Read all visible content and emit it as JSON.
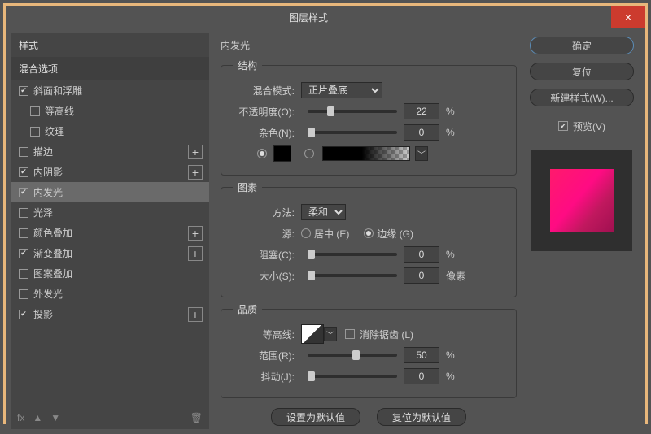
{
  "window": {
    "title": "图层样式",
    "close": "×"
  },
  "sidebar": {
    "styles_label": "样式",
    "blend_label": "混合选项",
    "items": [
      {
        "label": "斜面和浮雕",
        "checked": true,
        "plus": false,
        "indent": 0
      },
      {
        "label": "等高线",
        "checked": false,
        "plus": false,
        "indent": 1
      },
      {
        "label": "纹理",
        "checked": false,
        "plus": false,
        "indent": 1
      },
      {
        "label": "描边",
        "checked": false,
        "plus": true,
        "indent": 0
      },
      {
        "label": "内阴影",
        "checked": true,
        "plus": true,
        "indent": 0
      },
      {
        "label": "内发光",
        "checked": true,
        "plus": false,
        "indent": 0,
        "selected": true
      },
      {
        "label": "光泽",
        "checked": false,
        "plus": false,
        "indent": 0
      },
      {
        "label": "颜色叠加",
        "checked": false,
        "plus": true,
        "indent": 0
      },
      {
        "label": "渐变叠加",
        "checked": true,
        "plus": true,
        "indent": 0
      },
      {
        "label": "图案叠加",
        "checked": false,
        "plus": false,
        "indent": 0
      },
      {
        "label": "外发光",
        "checked": false,
        "plus": false,
        "indent": 0
      },
      {
        "label": "投影",
        "checked": true,
        "plus": true,
        "indent": 0
      }
    ],
    "fx": "fx"
  },
  "main": {
    "title": "内发光",
    "structure": {
      "legend": "结构",
      "blend_mode_label": "混合模式:",
      "blend_mode_value": "正片叠底",
      "opacity_label": "不透明度(O):",
      "opacity_value": "22",
      "opacity_unit": "%",
      "noise_label": "杂色(N):",
      "noise_value": "0",
      "noise_unit": "%"
    },
    "elements": {
      "legend": "图素",
      "technique_label": "方法:",
      "technique_value": "柔和",
      "source_label": "源:",
      "center": "居中 (E)",
      "edge": "边缘 (G)",
      "choke_label": "阻塞(C):",
      "choke_value": "0",
      "choke_unit": "%",
      "size_label": "大小(S):",
      "size_value": "0",
      "size_unit": "像素"
    },
    "quality": {
      "legend": "品质",
      "contour_label": "等高线:",
      "antialias": "消除锯齿 (L)",
      "range_label": "范围(R):",
      "range_value": "50",
      "range_unit": "%",
      "jitter_label": "抖动(J):",
      "jitter_value": "0",
      "jitter_unit": "%"
    },
    "set_default": "设置为默认值",
    "reset_default": "复位为默认值"
  },
  "right": {
    "ok": "确定",
    "cancel": "复位",
    "new_style": "新建样式(W)...",
    "preview": "预览(V)"
  }
}
